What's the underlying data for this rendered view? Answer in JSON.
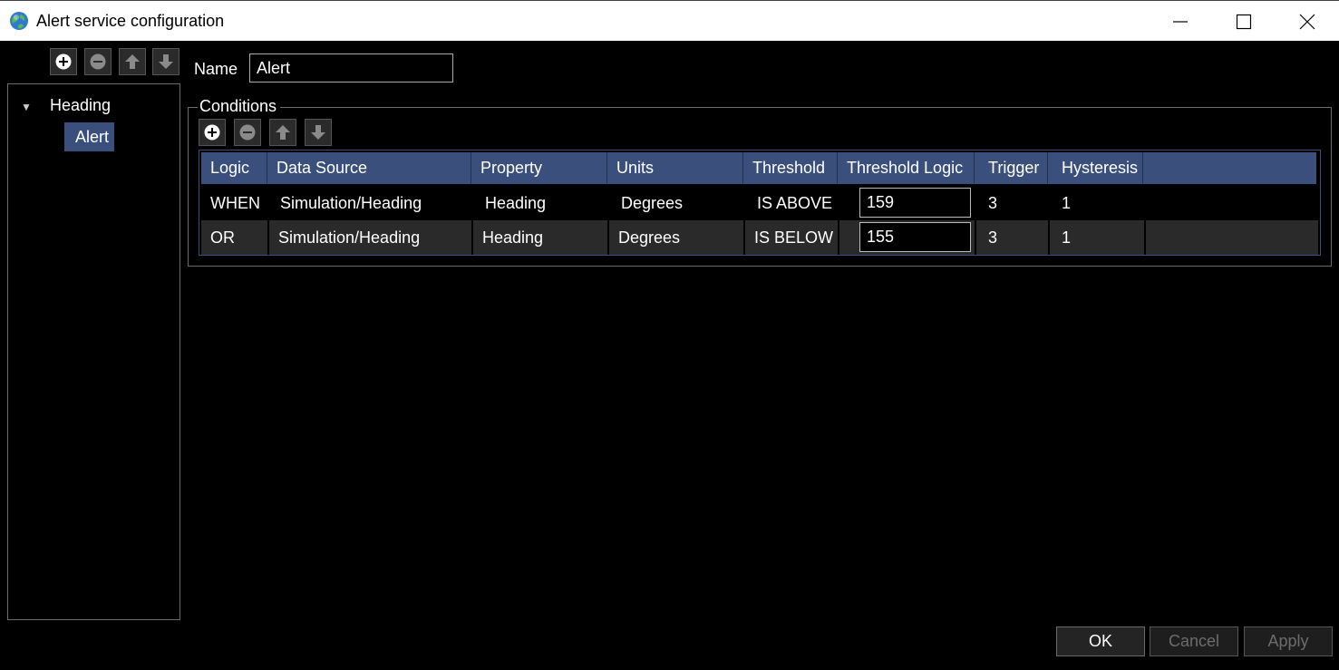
{
  "window": {
    "title": "Alert service configuration"
  },
  "icons": {
    "app": "globe-icon",
    "add": "plus-circle-icon",
    "remove": "minus-circle-icon",
    "move_up": "arrow-up-icon",
    "move_down": "arrow-down-icon",
    "expand": "triangle-down-icon"
  },
  "colors": {
    "background": "#000000",
    "accent": "#3b4f7d",
    "title_bar": "#ffffff",
    "disabled_text": "#6c6c6c"
  },
  "tree": {
    "arrow": "▼",
    "group_label": "Heading",
    "items": [
      {
        "label": "Alert",
        "selected": true
      }
    ]
  },
  "name_field": {
    "label": "Name",
    "value": "Alert"
  },
  "conditions": {
    "title": "Conditions",
    "columns": [
      "Logic",
      "Data Source",
      "Property",
      "Units",
      "Threshold",
      "Threshold Logic",
      "Trigger",
      "Hysteresis"
    ],
    "rows": [
      {
        "logic": "WHEN",
        "data_source": "Simulation/Heading",
        "property": "Heading",
        "units": "Degrees",
        "threshold": "IS ABOVE",
        "threshold_logic": "159",
        "trigger": "3",
        "hysteresis": "1"
      },
      {
        "logic": "OR",
        "data_source": "Simulation/Heading",
        "property": "Heading",
        "units": "Degrees",
        "threshold": "IS BELOW",
        "threshold_logic": "155",
        "trigger": "3",
        "hysteresis": "1"
      }
    ]
  },
  "buttons": {
    "ok": "OK",
    "cancel": "Cancel",
    "apply": "Apply"
  }
}
